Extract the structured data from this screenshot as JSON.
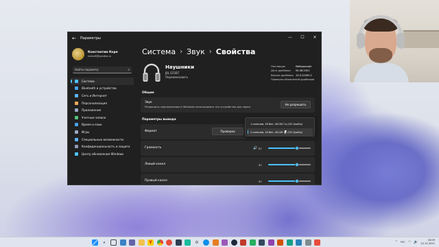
{
  "window": {
    "title": "Параметры",
    "minimize": "—",
    "maximize": "☐",
    "close": "✕"
  },
  "profile": {
    "name": "Константин Корн",
    "email": "roa1e6@yandex.ru"
  },
  "search": {
    "placeholder": "Найти параметр"
  },
  "sidebar": {
    "items": [
      {
        "label": "Система",
        "icon": "monitor-icon",
        "color": "#4cc2ff",
        "active": true
      },
      {
        "label": "Bluetooth и устройства",
        "icon": "bluetooth-icon",
        "color": "#4aa3e8"
      },
      {
        "label": "Сеть и Интернет",
        "icon": "network-icon",
        "color": "#5fb3ff"
      },
      {
        "label": "Персонализация",
        "icon": "brush-icon",
        "color": "#f2a65a"
      },
      {
        "label": "Приложения",
        "icon": "apps-icon",
        "color": "#9aa8c4"
      },
      {
        "label": "Учетные записи",
        "icon": "account-icon",
        "color": "#52c47a"
      },
      {
        "label": "Время и язык",
        "icon": "globe-icon",
        "color": "#4aa3e8"
      },
      {
        "label": "Игры",
        "icon": "gamepad-icon",
        "color": "#9aa8c4"
      },
      {
        "label": "Специальные возможности",
        "icon": "accessibility-icon",
        "color": "#5fb3ff"
      },
      {
        "label": "Конфиденциальность и защита",
        "icon": "shield-icon",
        "color": "#8f9bb3"
      },
      {
        "label": "Центр обновления Windows",
        "icon": "update-icon",
        "color": "#4cc2ff"
      }
    ]
  },
  "breadcrumb": {
    "part1": "Система",
    "sep": "›",
    "part2": "Звук",
    "part3": "Свойства"
  },
  "device": {
    "name": "Наушники",
    "model": "JBL E55BT",
    "rename": "Переименовать",
    "info": [
      {
        "key": "Поставщик",
        "value": "Майкрософт"
      },
      {
        "key": "Дата драйвера",
        "value": "04.06.2021"
      },
      {
        "key": "Версия драйвера",
        "value": "10.0.22000.1"
      },
      {
        "key": "Проверка обновлений драйверов",
        "value": ""
      }
    ]
  },
  "general": {
    "section_label": "Общие",
    "audio_title": "Звук",
    "audio_desc": "Разрешить приложениям и Windows использовать это устройство для звука",
    "deny_button": "Не разрешать"
  },
  "output": {
    "section_label": "Параметры вывода",
    "format_label": "Формат",
    "test_button": "Проверка",
    "volume_label": "Громкость",
    "left_label": "Левый канал",
    "right_label": "Правый канал",
    "volume_value": 67,
    "left_value": 67,
    "right_value": 67,
    "volume_icon": "🔊"
  },
  "dropdown": {
    "options": [
      "1 каналов, 16 бит, 44100 Гц (CD Quality)",
      "2 каналов, 16 бит, 44100 Гц (CD Quality)"
    ]
  },
  "taskbar": {
    "lang": "РУС",
    "time": "18:09",
    "date": "22.12.2021"
  }
}
